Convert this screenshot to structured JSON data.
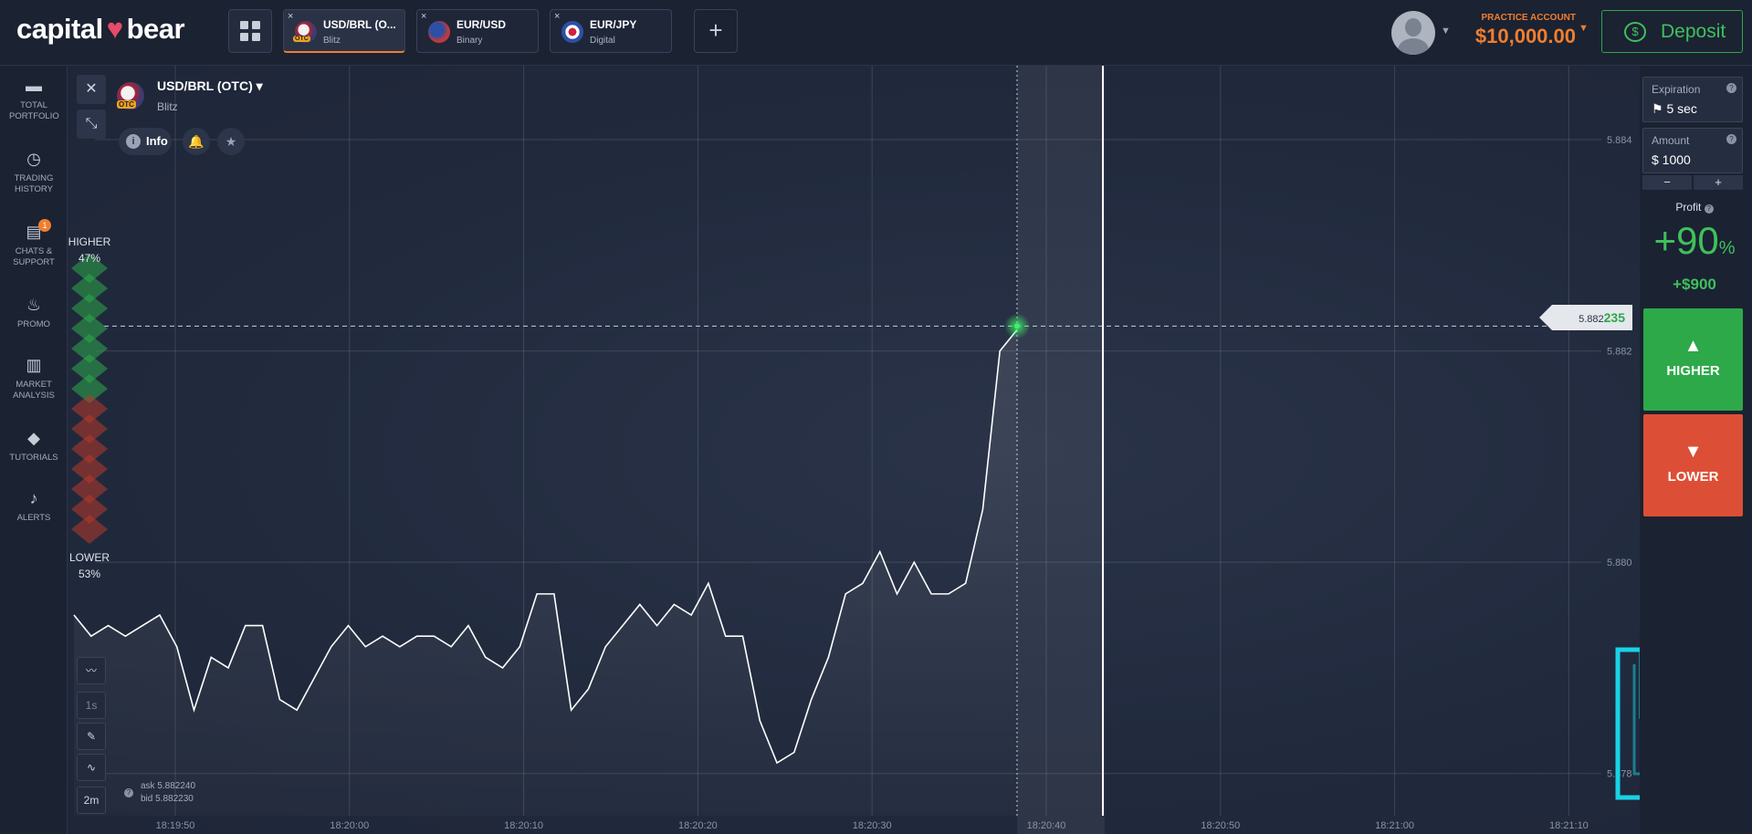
{
  "header": {
    "logo_left": "capital",
    "logo_right": "bear",
    "tabs": [
      {
        "close": "×",
        "name": "USD/BRL (O...",
        "type": "Blitz",
        "otc": "OTC",
        "active": true
      },
      {
        "close": "×",
        "name": "EUR/USD",
        "type": "Binary"
      },
      {
        "close": "×",
        "name": "EUR/JPY",
        "type": "Digital"
      }
    ],
    "add_tab": "+",
    "account_label": "PRACTICE ACCOUNT",
    "balance": "$10,000.00",
    "deposit_label": "Deposit",
    "deposit_icon_glyph": "$"
  },
  "sidebar": {
    "items": [
      {
        "label": "TOTAL PORTFOLIO",
        "icon": "briefcase-icon",
        "glyph": "▬"
      },
      {
        "label": "TRADING HISTORY",
        "icon": "clock-icon",
        "glyph": "◷"
      },
      {
        "label": "CHATS & SUPPORT",
        "icon": "chat-icon",
        "glyph": "▤",
        "badge": "1"
      },
      {
        "label": "PROMO",
        "icon": "fire-icon",
        "glyph": "♨"
      },
      {
        "label": "MARKET ANALYSIS",
        "icon": "analysis-icon",
        "glyph": "▥"
      },
      {
        "label": "TUTORIALS",
        "icon": "graduation-cap-icon",
        "glyph": "◆"
      },
      {
        "label": "ALERTS",
        "icon": "bell-icon",
        "glyph": "♪"
      }
    ]
  },
  "chart_panel": {
    "close_glyph": "✕",
    "minimize_glyph": "⤡",
    "asset_name": "USD/BRL (OTC)",
    "asset_caret": "▾",
    "asset_type": "Blitz",
    "otc_badge": "OTC",
    "info_label": "Info",
    "info_glyph": "i",
    "bell_glyph": "🔔",
    "star_glyph": "★",
    "sentiment_higher_label": "HIGHER",
    "sentiment_higher_pct": "47%",
    "sentiment_lower_label": "LOWER",
    "sentiment_lower_pct": "53%",
    "tools": [
      "",
      "1s",
      "",
      "",
      "2m"
    ],
    "ask": "ask 5.882240",
    "bid": "bid 5.882230",
    "price_tag_prefix": "5.882",
    "price_tag_highlight": "235"
  },
  "chart_data": {
    "type": "line",
    "title": "",
    "xlabel": "",
    "ylabel": "",
    "x_ticks": [
      "18:19:50",
      "18:20:00",
      "18:20:10",
      "18:20:20",
      "18:20:30",
      "18:20:40",
      "18:20:50",
      "18:21:00",
      "18:21:10"
    ],
    "y_ticks": [
      "5.884",
      "5.882",
      "5.880",
      "5.878"
    ],
    "ylim": [
      5.8776,
      5.8847
    ],
    "series": [
      {
        "values": [
          5.8795,
          5.8793,
          5.8794,
          5.8793,
          5.8794,
          5.8795,
          5.8792,
          5.8786,
          5.8791,
          5.879,
          5.8794,
          5.8794,
          5.8787,
          5.8786,
          5.8789,
          5.8792,
          5.8794,
          5.8792,
          5.8793,
          5.8792,
          5.8793,
          5.8793,
          5.8792,
          5.8794,
          5.8791,
          5.879,
          5.8792,
          5.8797,
          5.8797,
          5.8786,
          5.8788,
          5.8792,
          5.8794,
          5.8796,
          5.8794,
          5.8796,
          5.8795,
          5.8798,
          5.8793,
          5.8793,
          5.8785,
          5.8781,
          5.8782,
          5.8787,
          5.8791,
          5.8797,
          5.8798,
          5.8801,
          5.8797,
          5.88,
          5.8797,
          5.8797,
          5.8798,
          5.8805,
          5.882,
          5.8822
        ]
      }
    ],
    "current_price": 5.882235,
    "grid": true
  },
  "right_panel": {
    "expiration_label": "Expiration",
    "expiration_value": "5 sec",
    "expiration_glyph": "⚑",
    "amount_label": "Amount",
    "amount_value": "$ 1000",
    "help_glyph": "?",
    "minus": "−",
    "plus": "+",
    "profit_label": "Profit",
    "profit_pct": "+90",
    "profit_pct_sign": "%",
    "profit_amount": "+$900",
    "higher_label": "HIGHER",
    "lower_label": "LOWER",
    "higher_glyph": "▲",
    "lower_glyph": "▼"
  },
  "colors": {
    "background": "#1d2435",
    "accent_orange": "#f07e2e",
    "green": "#2da94a",
    "red": "#dc4f36",
    "watermark": "#18d3e6"
  }
}
